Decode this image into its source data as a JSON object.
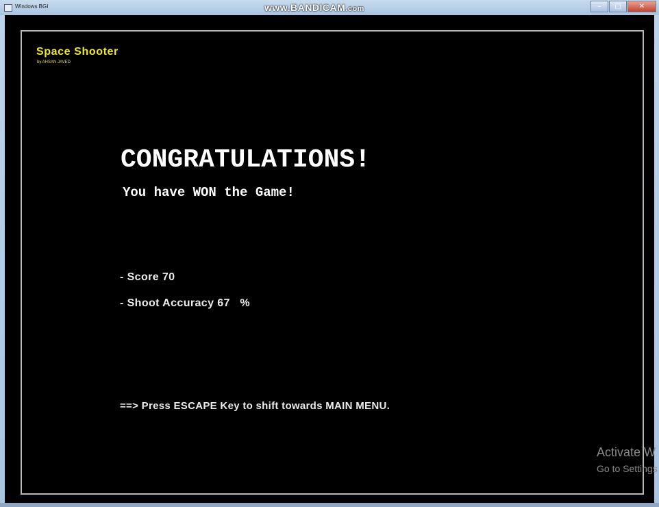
{
  "window": {
    "title": "Windows BGI",
    "watermark_main": "www.BANDICAM",
    "watermark_suffix": ".com",
    "controls": {
      "minimize": "–",
      "maximize": "□",
      "close": "✕"
    }
  },
  "game": {
    "title": "Space Shooter",
    "author": "by AHSAN JAVED",
    "headline": "CONGRATULATIONS!",
    "subheadline": "You have WON the Game!",
    "score_line": "- Score 70",
    "accuracy_line": "- Shoot Accuracy 67   %",
    "escape_hint": "==> Press ESCAPE Key to shift towards MAIN MENU.",
    "colors": {
      "title": "#f0ea18",
      "text": "#ffffff",
      "frame": "#b9b9b9",
      "background": "#000000"
    }
  },
  "overlay": {
    "activate_title": "Activate W",
    "activate_sub": "Go to Settings"
  }
}
